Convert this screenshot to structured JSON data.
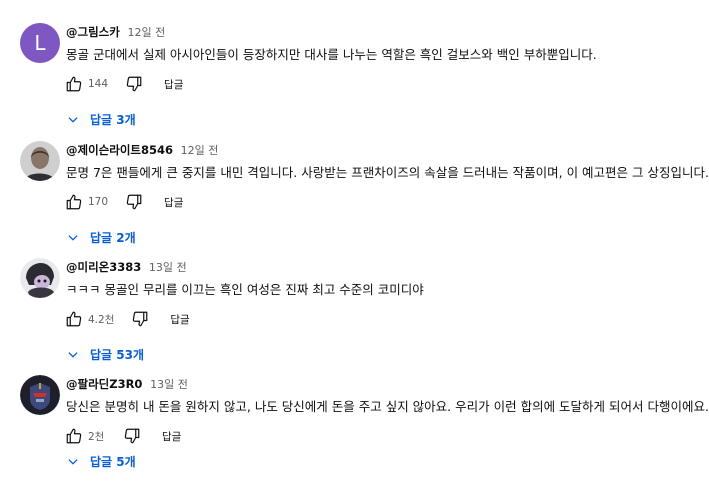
{
  "comments": [
    {
      "avatar_letter": "L",
      "author": "@그림스카",
      "time": "12일 전",
      "text": "몽골 군대에서 실제 아시아인들이 등장하지만 대사를 나누는 역할은 흑인 걸보스와 백인 부하뿐입니다.",
      "likes": "144",
      "reply_label": "답글",
      "replies_label": "답글 3개"
    },
    {
      "author": "@제이슨라이트8546",
      "time": "12일 전",
      "text": "문명 7은 팬들에게 큰 중지를 내민 격입니다. 사랑받는 프랜차이즈의 속살을 드러내는 작품이며, 이 예고편은 그 상징입니다.",
      "likes": "170",
      "reply_label": "답글",
      "replies_label": "답글 2개"
    },
    {
      "author": "@미리온3383",
      "time": "13일 전",
      "text": "ㅋㅋㅋ 몽골인 무리를 이끄는 흑인 여성은 진짜 최고 수준의 코미디야",
      "likes": "4.2천",
      "reply_label": "답글",
      "replies_label": "답글 53개"
    },
    {
      "author": "@팔라딘Z3R0",
      "time": "13일 전",
      "text": "당신은 분명히 내 돈을 원하지 않고, 나도 당신에게 돈을 주고 싶지 않아요. 우리가 이런 합의에 도달하게 되어서 다행이에요.",
      "likes": "2천",
      "reply_label": "답글",
      "replies_label": "답글 5개"
    }
  ],
  "colors": {
    "link": "#065fd4",
    "meta": "#606060",
    "avatar_letter_bg": "#7e57c2"
  },
  "icons": [
    "thumb-up-icon",
    "thumb-down-icon",
    "chevron-down-icon"
  ]
}
